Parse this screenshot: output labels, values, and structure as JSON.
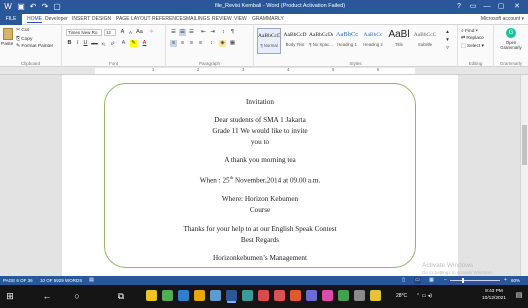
{
  "window": {
    "title": "file_Revisi Kembali - Word (Product Activation Failed)",
    "controls": [
      "?",
      "▭",
      "—",
      "▢",
      "✕"
    ]
  },
  "quick_access": [
    "save-icon",
    "undo-icon",
    "redo-icon",
    "new-document-icon"
  ],
  "tabs": [
    {
      "label": "FILE"
    },
    {
      "label": "HOME"
    },
    {
      "label": "Developer"
    },
    {
      "label": "INSERT"
    },
    {
      "label": "DESIGN"
    },
    {
      "label": "PAGE LAYOUT"
    },
    {
      "label": "REFERENCES"
    },
    {
      "label": "MAILINGS"
    },
    {
      "label": "REVIEW"
    },
    {
      "label": "VIEW"
    },
    {
      "label": "GRAMMARLY"
    }
  ],
  "account": "Microsoft account ▾",
  "ribbon": {
    "clipboard": {
      "paste": "Paste",
      "cut": "Cut",
      "copy": "Copy",
      "format_painter": "Format Painter",
      "label": "Clipboard"
    },
    "font": {
      "name": "Times New Ro",
      "size": "12",
      "label": "Font",
      "buttons": [
        "A",
        "A",
        "Aa",
        "B",
        "I",
        "U",
        "abc",
        "x₂",
        "x²",
        "A",
        "A"
      ]
    },
    "paragraph": {
      "label": "Paragraph",
      "buttons": [
        "☰",
        "☰",
        "☰",
        "⇤",
        "⇥",
        "↕",
        "¶",
        "≡",
        "≡",
        "≡",
        "≡",
        "↕"
      ]
    },
    "styles": {
      "label": "Styles",
      "items": [
        {
          "sample": "AaBbCcDc",
          "name": "¶ Normal"
        },
        {
          "sample": "AaBbCcD",
          "name": "Body Text"
        },
        {
          "sample": "AaBbCcDc",
          "name": "¶ No Spac..."
        },
        {
          "sample": "AaBbCc",
          "name": "Heading 1"
        },
        {
          "sample": "AaBbCc",
          "name": "Heading 2"
        },
        {
          "sample": "AaBl",
          "name": "Title"
        },
        {
          "sample": "AaBbCcC",
          "name": "Subtitle"
        }
      ]
    },
    "editing": {
      "find": "Find ▾",
      "replace": "Replace",
      "select": "Select ▾",
      "label": "Editing"
    },
    "grammarly": {
      "open": "Open Grammarly",
      "label": "Grammarly"
    }
  },
  "ruler": {
    "numbers": [
      "1",
      "2",
      "3",
      "4",
      "5",
      "6"
    ]
  },
  "document": {
    "lines": [
      {
        "text": "Invitation"
      },
      {
        "text": "Dear students of SMA 1 Jakarta"
      },
      {
        "text": "Grade 11 We would like to invite"
      },
      {
        "text": "you to"
      },
      {
        "text": "A thank you morning tea"
      },
      {
        "before": "When : 25",
        "sup": "th",
        "after": " November,2014 at 09.00 a.m."
      },
      {
        "text": "Where: Horizon Kebumen"
      },
      {
        "text": "Course"
      },
      {
        "text": "Thanks for your help to at our English Speak Contest"
      },
      {
        "text": "Best Regards"
      },
      {
        "text": "Horizonkebumen’s Management"
      }
    ],
    "watermark": {
      "title": "Activate Windows",
      "subtitle": "Go to Settings to activate Windows."
    }
  },
  "status": {
    "page": "PAGE 6 OF 36",
    "words": "10 OF 5929 WORDS",
    "zoom_percent": 60
  },
  "taskbar": {
    "icons": [
      "windows-start-icon",
      "back-icon",
      "search-icon",
      "task-view-icon"
    ],
    "apps": [
      {
        "name": "file-explorer",
        "color": "#f2c02e"
      },
      {
        "name": "chrome",
        "color": "#4caf50"
      },
      {
        "name": "ie",
        "color": "#2a7fd4"
      },
      {
        "name": "explorer2",
        "color": "#e8a317"
      },
      {
        "name": "store",
        "color": "#5a9bd8"
      },
      {
        "name": "word-active",
        "color": "#2b579a"
      },
      {
        "name": "app7",
        "color": "#3b9a9a"
      },
      {
        "name": "app8",
        "color": "#d94b4b"
      },
      {
        "name": "app9",
        "color": "#d9534f"
      },
      {
        "name": "app10",
        "color": "#e05a2b"
      },
      {
        "name": "app11",
        "color": "#6a6ad8"
      },
      {
        "name": "app12",
        "color": "#d94bb0"
      },
      {
        "name": "app13",
        "color": "#3fa34d"
      },
      {
        "name": "app14",
        "color": "#8a8a8a"
      },
      {
        "name": "app15",
        "color": "#e8c13a"
      }
    ],
    "tray": {
      "temp": "28°C",
      "time": "9:43 PM",
      "date": "10/12/2021"
    }
  },
  "colors": {
    "word_blue": "#2b579a",
    "frame_green": "#8fb86a",
    "taskbar": "#151515"
  }
}
